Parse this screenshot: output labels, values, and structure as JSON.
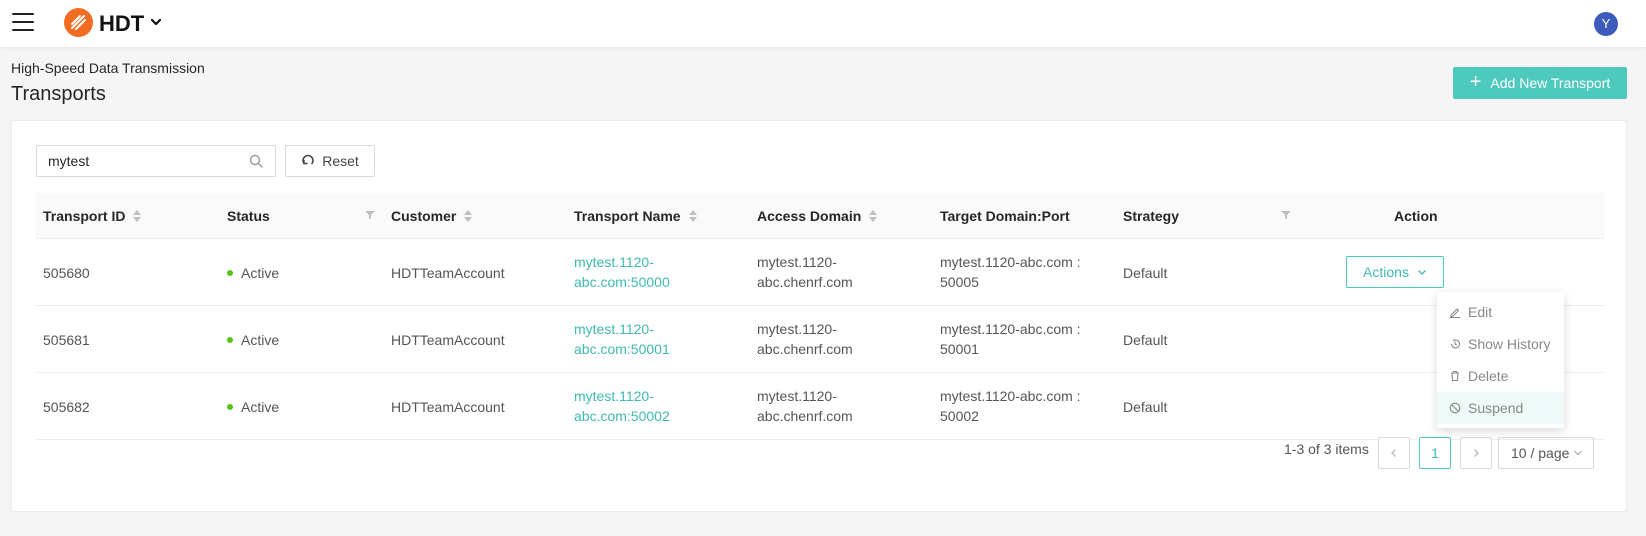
{
  "app": {
    "name": "HDT",
    "user_initial": "Y"
  },
  "page": {
    "breadcrumb": "High-Speed Data Transmission",
    "title": "Transports",
    "add_button": "Add New Transport"
  },
  "toolbar": {
    "search_value": "mytest",
    "reset_label": "Reset"
  },
  "table": {
    "columns": {
      "transport_id": "Transport ID",
      "status": "Status",
      "customer": "Customer",
      "transport_name": "Transport Name",
      "access_domain": "Access Domain",
      "target": "Target Domain:Port",
      "strategy": "Strategy",
      "action": "Action"
    },
    "rows": [
      {
        "id": "505680",
        "status": "Active",
        "customer": "HDTTeamAccount",
        "name_line1": "mytest.1120-",
        "name_line2": "abc.com:50000",
        "access_line1": "mytest.1120-",
        "access_line2": "abc.chenrf.com",
        "target_line1": "mytest.1120-abc.com :",
        "target_line2": "50005",
        "strategy": "Default"
      },
      {
        "id": "505681",
        "status": "Active",
        "customer": "HDTTeamAccount",
        "name_line1": "mytest.1120-",
        "name_line2": "abc.com:50001",
        "access_line1": "mytest.1120-",
        "access_line2": "abc.chenrf.com",
        "target_line1": "mytest.1120-abc.com :",
        "target_line2": "50001",
        "strategy": "Default"
      },
      {
        "id": "505682",
        "status": "Active",
        "customer": "HDTTeamAccount",
        "name_line1": "mytest.1120-",
        "name_line2": "abc.com:50002",
        "access_line1": "mytest.1120-",
        "access_line2": "abc.chenrf.com",
        "target_line1": "mytest.1120-abc.com :",
        "target_line2": "50002",
        "strategy": "Default"
      }
    ],
    "actions_label": "Actions"
  },
  "dropdown": {
    "items": [
      "Edit",
      "Show History",
      "Delete",
      "Suspend"
    ]
  },
  "pagination": {
    "total": "1-3 of 3 items",
    "current_page": "1",
    "page_size": "10 / page"
  },
  "colors": {
    "accent": "#4ec9bd",
    "logo": "#f26c21",
    "active_dot": "#52c41a",
    "avatar": "#3d5bbd"
  }
}
